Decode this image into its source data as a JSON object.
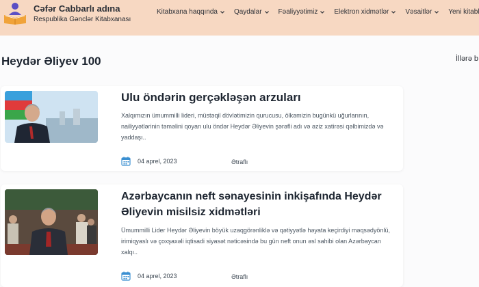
{
  "header": {
    "brand_title": "Cəfər Cabbarlı adına",
    "brand_subtitle": "Respublika Gənclər Kitabxanası",
    "bg_color": "#f7d8c2",
    "nav": [
      {
        "label": "Kitabxana haqqında",
        "has_dropdown": true
      },
      {
        "label": "Qaydalar",
        "has_dropdown": true
      },
      {
        "label": "Fəaliyyətimiz",
        "has_dropdown": true
      },
      {
        "label": "Elektron xidmətlər",
        "has_dropdown": true
      },
      {
        "label": "Vəsaitlər",
        "has_dropdown": true
      },
      {
        "label": "Yeni kitablar",
        "has_dropdown": false
      }
    ]
  },
  "page": {
    "title": "Heydər Əliyev 100",
    "side_text": "İllərə b"
  },
  "articles": [
    {
      "title": "Ulu öndərin gerçəkləşən arzuları",
      "excerpt": "Xalqımızın ümummilli lideri, müstəqil dövlətimizin qurucusu, ölkəmizin bugünkü uğurlarının, nailiyyətlərinin təməlini qoyan ulu öndər Heydər Əliyevin şərəfli adı və əziz xatirəsi qəlbimizdə və yaddaşı..",
      "date": "04 aprel, 2023",
      "more": "Ətraflı"
    },
    {
      "title": "Azərbaycanın neft sənayesinin inkişafında Heydər Əliyevin misilsiz xidmətləri",
      "excerpt": "Ümummilli Lider Heydər Əliyevin böyük uzaqgörənliklə və qətiyyətlə həyata keçirdiyi məqsədyönlü, irimiqyaslı və çoxşaxəli iqtisadi siyasət nəticəsində bu gün neft onun əsl sahibi olan Azərbaycan xalqı..",
      "date": "04 aprel, 2023",
      "more": "Ətraflı"
    }
  ],
  "icons": {
    "logo": "reading-person-logo-icon",
    "calendar": "calendar-icon",
    "dropdown": "chevron-down-icon"
  },
  "colors": {
    "accent_blue": "#3a8fd1",
    "text_dark": "#1d2530"
  }
}
